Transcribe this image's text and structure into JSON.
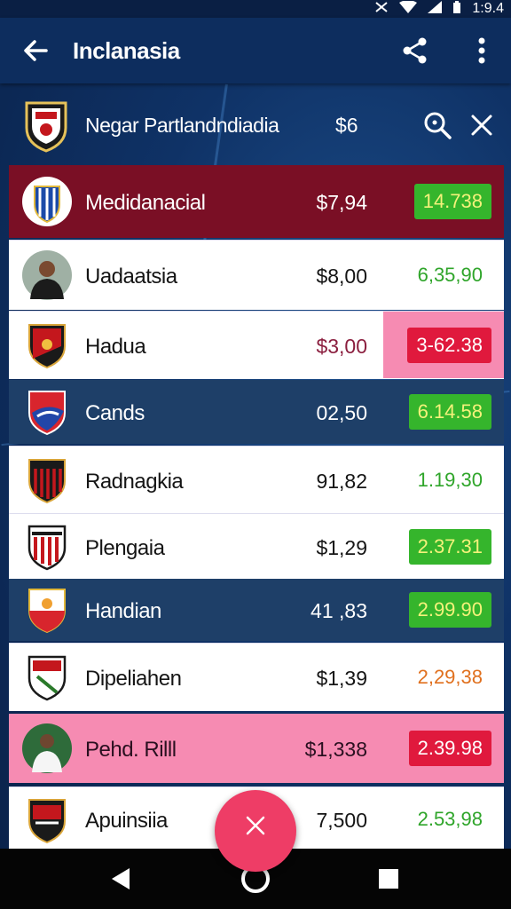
{
  "status_bar": {
    "time": "1:9.4",
    "icons": [
      "notification-icon",
      "wifi-icon",
      "signal-icon",
      "battery-icon"
    ]
  },
  "app_bar": {
    "title": "Inclanasia",
    "actions": [
      "back-arrow-icon",
      "share-icon",
      "more-vert-icon"
    ]
  },
  "sub_header": {
    "title": "Negar Partlandndiadia",
    "price": "$6",
    "actions": [
      "search-icon",
      "close-icon"
    ]
  },
  "rows": [
    {
      "name": "Medidanacial",
      "price": "$7,94",
      "change": "14.738",
      "style": "maroon",
      "change_style": "green-box"
    },
    {
      "name": "Uadaatsia",
      "price": "$8,00",
      "change": "6,35,90",
      "style": "white",
      "change_style": "green-text"
    },
    {
      "name": "Hadua",
      "price": "$3,00",
      "change": "3-62.38",
      "style": "white",
      "change_style": "red-box"
    },
    {
      "name": "Cands",
      "price": "02,50",
      "change": "6.14.58",
      "style": "navy",
      "change_style": "green-box"
    },
    {
      "name": "Radnagkia",
      "price": "91,82",
      "change": "1.19,30",
      "style": "white",
      "change_style": "green-text"
    },
    {
      "name": "Plengaia",
      "price": "$1,29",
      "change": "2.37.31",
      "style": "white",
      "change_style": "green-box"
    },
    {
      "name": "Handian",
      "price": "41 ,83",
      "change": "2.99.90",
      "style": "navy",
      "change_style": "green-box"
    },
    {
      "name": "Dipeliahen",
      "price": "$1,39",
      "change": "2,29,38",
      "style": "white",
      "change_style": "orange-text"
    },
    {
      "name": "Pehd. Rilll",
      "price": "$1,338",
      "change": "2.39.98",
      "style": "pink",
      "change_style": "red-box"
    },
    {
      "name": "Apuinsiia",
      "price": "7,500",
      "change": "2.53,98",
      "style": "white",
      "change_style": "green-text"
    }
  ],
  "fab": {
    "icon": "close-icon"
  },
  "nav_bar": {
    "icons": [
      "nav-back-icon",
      "nav-home-icon",
      "nav-recents-icon"
    ]
  },
  "colors": {
    "app_bar": "#0d2d5e",
    "maroon_row": "#7a0f25",
    "navy_row": "#1e3f68",
    "pink_row": "#f68bb2",
    "green_box": "#35b52c",
    "red_box": "#e0193d",
    "fab": "#ee3d66"
  }
}
